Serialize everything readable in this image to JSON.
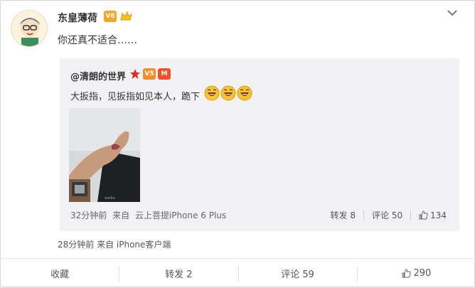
{
  "post": {
    "username": "东皇薄荷",
    "text": "你还真不适合……",
    "meta": "28分钟前 来自 iPhone客户端"
  },
  "repost": {
    "username": "@清朗的世界",
    "text": "大扳指，见扳指如见本人，跪下",
    "time": "32分钟前",
    "source_prefix": "来自",
    "source": "云上菩提iPhone 6 Plus",
    "forward_label": "转发 8",
    "comment_label": "评论 50",
    "like_count": "134"
  },
  "actions": {
    "favorite": "收藏",
    "forward": "转发 2",
    "comment": "评论 59",
    "like": "290"
  },
  "colors": {
    "accent_orange": "#f6a623",
    "repost_bg": "#f2f2f5",
    "page_bg": "#e6e6ed"
  },
  "icons": {
    "menu": "chevron-down-icon",
    "like": "thumbs-up-icon",
    "emoji": "laughing-emoji-icon",
    "star": "red-star-icon"
  }
}
